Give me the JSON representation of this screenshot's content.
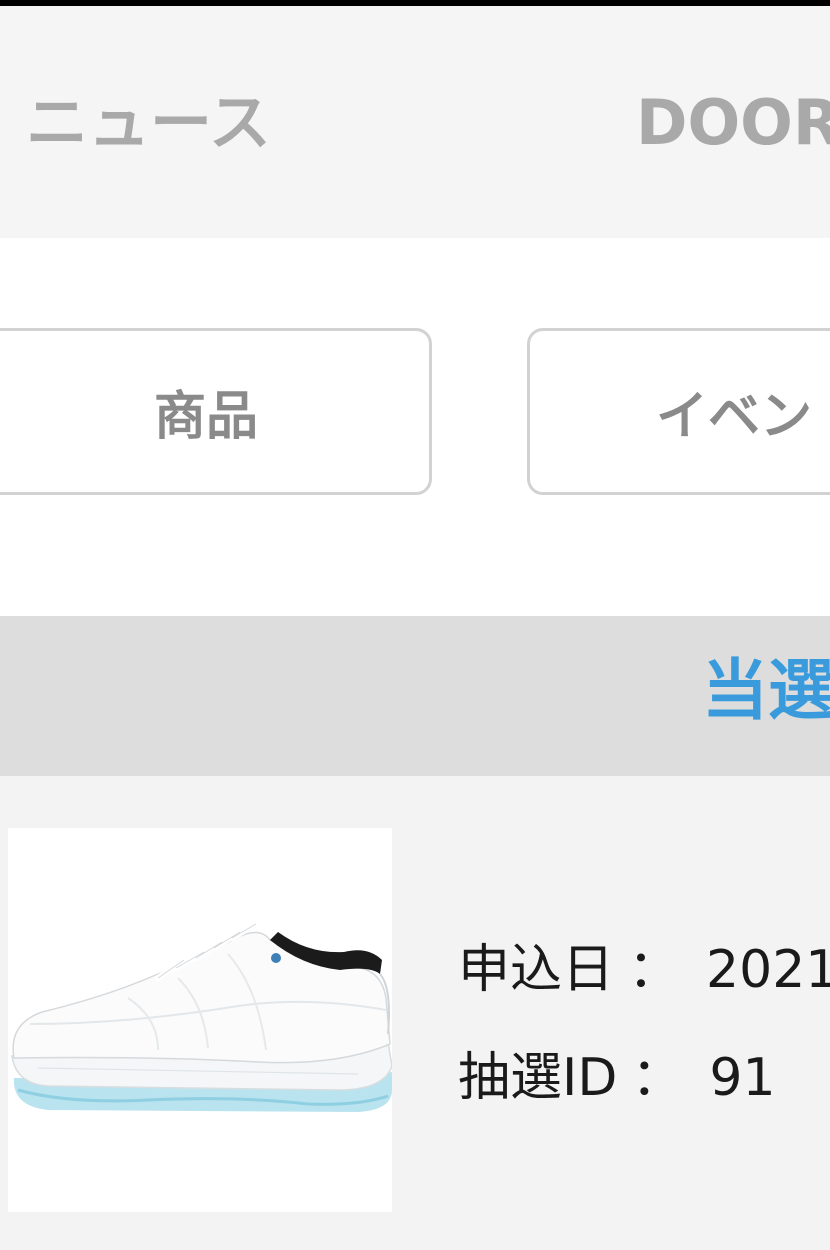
{
  "nav": {
    "items": [
      {
        "label": "ニュース"
      },
      {
        "label": "DOOR"
      }
    ]
  },
  "filters": {
    "product_label": "商品",
    "event_label": "イベン"
  },
  "status": {
    "label": "当選",
    "color": "#3a9bdc"
  },
  "entry": {
    "image": "sneaker-image",
    "date_label": "申込日",
    "date_value": "2021",
    "lottery_id_label": "抽選ID",
    "lottery_id_value": "91",
    "separator": "："
  }
}
